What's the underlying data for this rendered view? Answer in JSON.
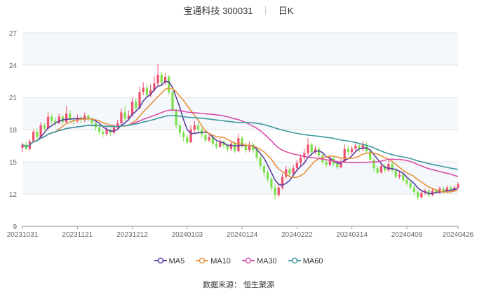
{
  "header": {
    "title": "宝通科技 300031",
    "period": "日K"
  },
  "footer": {
    "source": "数据来源： 恒生聚源"
  },
  "colors": {
    "up": "#f0506e",
    "down": "#7ce04b",
    "grid": "#e5e5e5",
    "band": "#f4f7fc",
    "axis": "#999999"
  },
  "chart_data": {
    "type": "candlestick",
    "title": "宝通科技 300031",
    "period": "日K",
    "ylim": [
      9,
      27
    ],
    "y_ticks": [
      9,
      12,
      15,
      18,
      21,
      24,
      27
    ],
    "x_tick_labels": [
      "20231031",
      "20231121",
      "20231212",
      "20240103",
      "20240124",
      "20240222",
      "20240314",
      "20240408",
      "20240426"
    ],
    "x_tick_index": [
      0,
      15,
      30,
      45,
      60,
      75,
      90,
      105,
      119
    ],
    "grid": true,
    "legend_position": "bottom",
    "candles": [
      [
        16.3,
        16.6,
        15.9,
        16.8
      ],
      [
        16.6,
        16.2,
        16.1,
        16.9
      ],
      [
        16.2,
        16.9,
        16.0,
        17.1
      ],
      [
        16.9,
        17.8,
        16.8,
        18.0
      ],
      [
        17.8,
        17.3,
        17.0,
        18.1
      ],
      [
        17.3,
        18.4,
        17.2,
        18.7
      ],
      [
        18.4,
        18.1,
        17.9,
        18.6
      ],
      [
        18.1,
        19.2,
        18.0,
        19.6
      ],
      [
        19.2,
        18.8,
        18.5,
        19.4
      ],
      [
        18.8,
        18.6,
        18.3,
        19.1
      ],
      [
        18.6,
        19.2,
        18.5,
        19.5
      ],
      [
        19.2,
        18.7,
        18.5,
        19.4
      ],
      [
        18.7,
        19.5,
        18.6,
        20.2
      ],
      [
        19.5,
        18.9,
        18.7,
        19.8
      ],
      [
        18.9,
        18.8,
        18.5,
        19.2
      ],
      [
        18.8,
        19.1,
        18.6,
        19.4
      ],
      [
        19.1,
        18.9,
        18.6,
        19.3
      ],
      [
        18.9,
        19.3,
        18.7,
        19.6
      ],
      [
        19.3,
        19.0,
        18.8,
        19.4
      ],
      [
        19.0,
        18.6,
        18.3,
        19.1
      ],
      [
        18.6,
        18.2,
        17.9,
        18.8
      ],
      [
        18.2,
        17.8,
        17.5,
        18.4
      ],
      [
        17.8,
        17.6,
        17.3,
        18.0
      ],
      [
        17.6,
        18.0,
        17.4,
        18.3
      ],
      [
        18.0,
        17.7,
        17.4,
        18.1
      ],
      [
        17.7,
        18.2,
        17.6,
        18.5
      ],
      [
        18.2,
        18.6,
        18.0,
        18.9
      ],
      [
        18.6,
        19.6,
        18.5,
        20.0
      ],
      [
        19.6,
        19.0,
        18.8,
        20.2
      ],
      [
        19.0,
        19.3,
        18.8,
        19.8
      ],
      [
        19.3,
        20.6,
        19.2,
        21.0
      ],
      [
        20.6,
        20.0,
        19.7,
        20.9
      ],
      [
        20.0,
        21.5,
        19.9,
        22.0
      ],
      [
        21.5,
        21.9,
        21.2,
        22.4
      ],
      [
        21.9,
        21.2,
        21.0,
        22.3
      ],
      [
        21.2,
        21.7,
        21.0,
        22.2
      ],
      [
        21.7,
        22.3,
        21.5,
        23.0
      ],
      [
        22.3,
        23.1,
        22.0,
        24.1
      ],
      [
        23.1,
        22.4,
        22.0,
        23.4
      ],
      [
        22.4,
        22.9,
        22.1,
        23.3
      ],
      [
        22.9,
        21.5,
        21.2,
        23.1
      ],
      [
        21.5,
        19.8,
        19.5,
        21.7
      ],
      [
        19.8,
        18.4,
        18.1,
        20.0
      ],
      [
        18.4,
        17.7,
        17.3,
        18.6
      ],
      [
        17.7,
        17.3,
        16.9,
        17.9
      ],
      [
        17.3,
        16.8,
        16.6,
        17.5
      ],
      [
        16.8,
        18.0,
        16.8,
        18.4
      ],
      [
        18.0,
        18.4,
        17.7,
        18.8
      ],
      [
        18.4,
        18.0,
        17.7,
        18.6
      ],
      [
        18.0,
        17.5,
        17.2,
        18.2
      ],
      [
        17.5,
        17.0,
        16.8,
        17.7
      ],
      [
        17.0,
        17.3,
        16.8,
        17.6
      ],
      [
        17.3,
        16.7,
        16.5,
        17.4
      ],
      [
        16.7,
        16.4,
        16.2,
        16.9
      ],
      [
        16.4,
        16.9,
        16.3,
        17.2
      ],
      [
        16.9,
        16.5,
        16.3,
        17.0
      ],
      [
        16.5,
        16.2,
        15.9,
        16.7
      ],
      [
        16.2,
        16.7,
        16.0,
        17.0
      ],
      [
        16.7,
        16.0,
        15.8,
        16.9
      ],
      [
        16.0,
        17.2,
        15.9,
        17.6
      ],
      [
        17.2,
        16.6,
        16.3,
        17.4
      ],
      [
        16.6,
        16.1,
        15.8,
        16.8
      ],
      [
        16.1,
        16.6,
        15.9,
        16.9
      ],
      [
        16.6,
        16.1,
        15.8,
        16.8
      ],
      [
        16.1,
        15.4,
        15.1,
        16.3
      ],
      [
        15.4,
        14.6,
        14.3,
        15.6
      ],
      [
        14.6,
        14.0,
        13.6,
        14.8
      ],
      [
        14.0,
        13.4,
        13.1,
        14.2
      ],
      [
        13.4,
        12.6,
        12.3,
        13.6
      ],
      [
        12.6,
        11.9,
        11.5,
        12.9
      ],
      [
        11.9,
        12.6,
        11.7,
        12.9
      ],
      [
        12.6,
        13.6,
        12.4,
        13.9
      ],
      [
        13.6,
        14.3,
        13.4,
        14.6
      ],
      [
        14.3,
        13.9,
        13.6,
        14.5
      ],
      [
        13.9,
        14.4,
        13.7,
        14.7
      ],
      [
        14.4,
        14.9,
        14.2,
        15.2
      ],
      [
        14.9,
        15.4,
        14.6,
        15.7
      ],
      [
        15.4,
        15.8,
        15.1,
        16.2
      ],
      [
        15.8,
        16.6,
        15.6,
        17.2
      ],
      [
        16.6,
        15.9,
        15.6,
        16.8
      ],
      [
        15.9,
        16.2,
        15.7,
        16.5
      ],
      [
        16.2,
        15.6,
        15.3,
        16.4
      ],
      [
        15.6,
        15.0,
        14.8,
        15.8
      ],
      [
        15.0,
        14.7,
        14.5,
        15.2
      ],
      [
        14.7,
        15.3,
        14.6,
        15.6
      ],
      [
        15.3,
        14.8,
        14.6,
        15.5
      ],
      [
        14.8,
        14.5,
        14.3,
        15.0
      ],
      [
        14.5,
        15.0,
        14.4,
        15.3
      ],
      [
        15.0,
        16.2,
        14.9,
        16.6
      ],
      [
        16.2,
        15.9,
        15.6,
        16.5
      ],
      [
        15.9,
        16.2,
        15.7,
        16.5
      ],
      [
        16.2,
        16.5,
        16.0,
        16.8
      ],
      [
        16.5,
        16.2,
        15.9,
        16.7
      ],
      [
        16.2,
        16.6,
        16.0,
        16.9
      ],
      [
        16.6,
        16.0,
        15.8,
        16.8
      ],
      [
        16.0,
        15.2,
        15.0,
        16.2
      ],
      [
        15.2,
        14.4,
        14.1,
        15.4
      ],
      [
        14.4,
        14.0,
        13.8,
        14.6
      ],
      [
        14.0,
        14.6,
        13.9,
        14.9
      ],
      [
        14.6,
        14.2,
        14.0,
        14.8
      ],
      [
        14.2,
        14.8,
        14.1,
        15.1
      ],
      [
        14.8,
        14.2,
        14.0,
        15.0
      ],
      [
        14.2,
        13.6,
        13.4,
        14.4
      ],
      [
        13.6,
        13.8,
        13.4,
        14.1
      ],
      [
        13.8,
        13.3,
        13.1,
        14.0
      ],
      [
        13.3,
        13.0,
        12.8,
        13.5
      ],
      [
        13.0,
        12.6,
        12.4,
        13.2
      ],
      [
        12.6,
        12.2,
        11.9,
        12.8
      ],
      [
        12.2,
        11.7,
        11.5,
        12.4
      ],
      [
        11.7,
        12.1,
        11.6,
        12.3
      ],
      [
        12.1,
        12.3,
        11.9,
        12.5
      ],
      [
        12.3,
        11.9,
        11.7,
        12.5
      ],
      [
        11.9,
        12.3,
        11.8,
        12.5
      ],
      [
        12.3,
        12.1,
        12.0,
        12.5
      ],
      [
        12.1,
        12.5,
        12.0,
        12.7
      ],
      [
        12.5,
        12.2,
        12.0,
        12.7
      ],
      [
        12.2,
        12.6,
        12.1,
        12.8
      ],
      [
        12.6,
        12.3,
        12.1,
        12.8
      ],
      [
        12.3,
        12.6,
        12.2,
        12.8
      ],
      [
        12.6,
        12.9,
        12.5,
        13.1
      ]
    ],
    "series": [
      {
        "name": "MA5",
        "color": "#5b3d9e"
      },
      {
        "name": "MA10",
        "color": "#e9913d"
      },
      {
        "name": "MA30",
        "color": "#d84fa9"
      },
      {
        "name": "MA60",
        "color": "#3c9a9c"
      }
    ]
  }
}
